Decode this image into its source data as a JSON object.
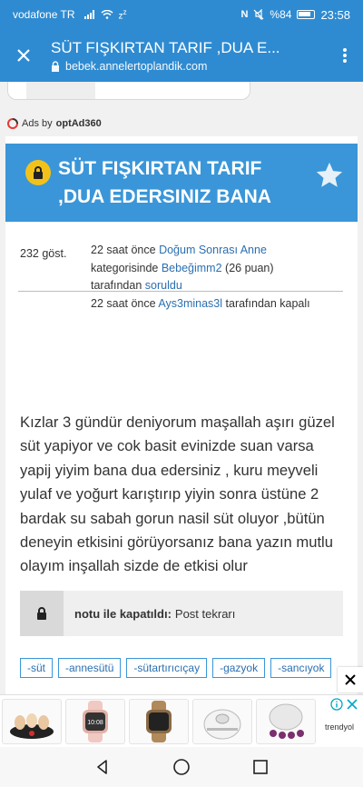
{
  "status_bar": {
    "carrier": "vodafone TR",
    "battery": "%84",
    "time": "23:58"
  },
  "browser": {
    "page_title": "SÜT FIŞKIRTAN TARIF ,DUA E...",
    "url": "bebek.annelertoplandik.com"
  },
  "ads": {
    "ads_by_prefix": "Ads by",
    "ads_by_brand": "optAd360",
    "bottom_brand": "trendyol"
  },
  "question": {
    "title": "SÜT FIŞKIRTAN TARIF ,DUA EDERSINIZ BANA",
    "views": "232 göst.",
    "asked_time": "22 saat önce",
    "category": "Doğum Sonrası Anne",
    "category_suffix": "kategorisinde",
    "author": "Bebeğimm2",
    "author_points": "(26 puan)",
    "asked_by_suffix": "tarafından",
    "asked_verb": "soruldu",
    "closed_time": "22 saat önce",
    "closer": "Ays3minas3l",
    "closed_suffix": "tarafından kapalı",
    "body": "Kızlar 3 gündür deniyorum maşallah aşırı güzel süt yapiyor ve cok basit  evinizde suan varsa yapij yiyim bana dua edersiniz , kuru meyveli yulaf  ve yoğurt karıştırıp  yiyin sonra üstüne 2 bardak su sabah gorun nasil süt oluyor ,bütün deneyin etkisini görüyorsanız bana yazın mutlu olayım inşallah sizde de etkisi olur",
    "closed_note_label": "notu ile kapatıldı:",
    "closed_note_value": "Post tekrarı",
    "tags": [
      "-süt",
      "-annesütü",
      "-sütartırıcıçay",
      "-gazyok",
      "-sancıyok"
    ]
  },
  "colors": {
    "primary": "#2f8bd1",
    "title_box": "#3a96d8",
    "link": "#2b6fb0",
    "lock_badge": "#f2c21b"
  }
}
